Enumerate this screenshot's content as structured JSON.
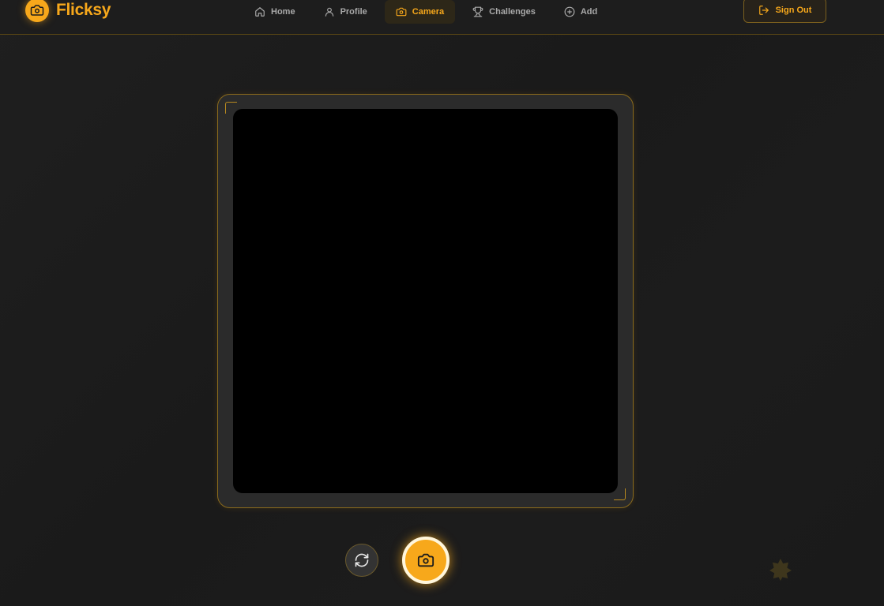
{
  "app": {
    "name": "Flicksy"
  },
  "nav": {
    "items": [
      {
        "label": "Home",
        "icon": "home-icon",
        "active": false
      },
      {
        "label": "Profile",
        "icon": "user-icon",
        "active": false
      },
      {
        "label": "Camera",
        "icon": "camera-icon",
        "active": true
      },
      {
        "label": "Challenges",
        "icon": "trophy-icon",
        "active": false
      },
      {
        "label": "Add",
        "icon": "plus-circle-icon",
        "active": false
      }
    ]
  },
  "header": {
    "signout_label": "Sign Out"
  },
  "colors": {
    "accent": "#f7a81b",
    "background": "#1c1c1c",
    "viewport": "#000000"
  }
}
